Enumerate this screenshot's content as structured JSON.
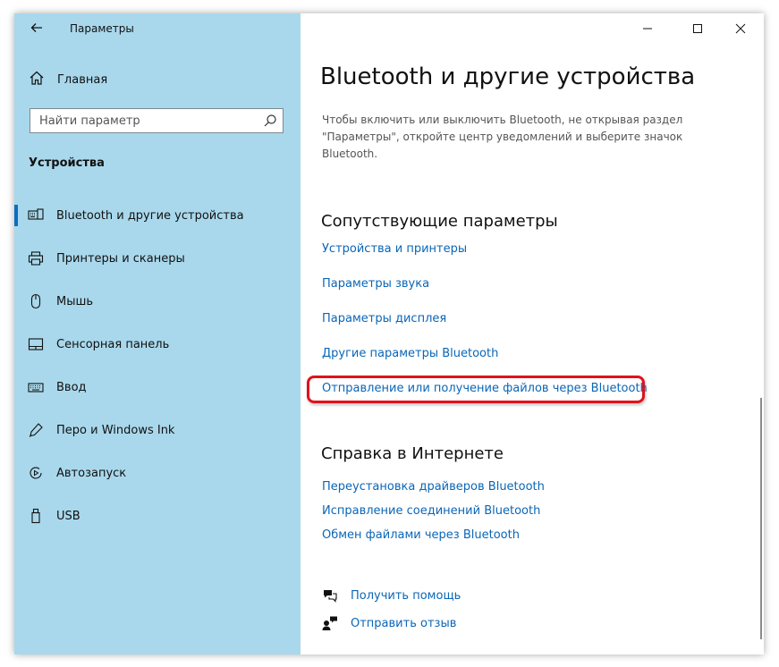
{
  "window": {
    "title": "Параметры",
    "back_icon": "back-arrow-icon",
    "minimize_icon": "minimize-icon",
    "maximize_icon": "maximize-icon",
    "close_icon": "close-icon"
  },
  "sidebar": {
    "home_label": "Главная",
    "search_placeholder": "Найти параметр",
    "section_title": "Устройства",
    "items": [
      {
        "label": "Bluetooth и другие устройства",
        "icon": "bluetooth-devices-icon",
        "active": true
      },
      {
        "label": "Принтеры и сканеры",
        "icon": "printer-icon",
        "active": false
      },
      {
        "label": "Мышь",
        "icon": "mouse-icon",
        "active": false
      },
      {
        "label": "Сенсорная панель",
        "icon": "touchpad-icon",
        "active": false
      },
      {
        "label": "Ввод",
        "icon": "keyboard-icon",
        "active": false
      },
      {
        "label": "Перо и Windows Ink",
        "icon": "pen-icon",
        "active": false
      },
      {
        "label": "Автозапуск",
        "icon": "autoplay-icon",
        "active": false
      },
      {
        "label": "USB",
        "icon": "usb-icon",
        "active": false
      }
    ]
  },
  "main": {
    "title": "Bluetooth и другие устройства",
    "description": "Чтобы включить или выключить Bluetooth, не открывая раздел \"Параметры\", откройте центр уведомлений и выберите значок Bluetooth.",
    "related": {
      "title": "Сопутствующие параметры",
      "links": [
        "Устройства и принтеры",
        "Параметры звука",
        "Параметры дисплея",
        "Другие параметры Bluetooth",
        "Отправление или получение файлов через Bluetooth"
      ]
    },
    "help": {
      "title": "Справка в Интернете",
      "links": [
        "Переустановка драйверов Bluetooth",
        "Исправление соединений Bluetooth",
        "Обмен файлами через Bluetooth"
      ]
    },
    "get_help": "Получить помощь",
    "feedback": "Отправить отзыв"
  },
  "colors": {
    "sidebar_bg": "#a9d8ec",
    "link": "#0a66b7",
    "accent": "#0a6ec2",
    "highlight": "#e0121b"
  }
}
